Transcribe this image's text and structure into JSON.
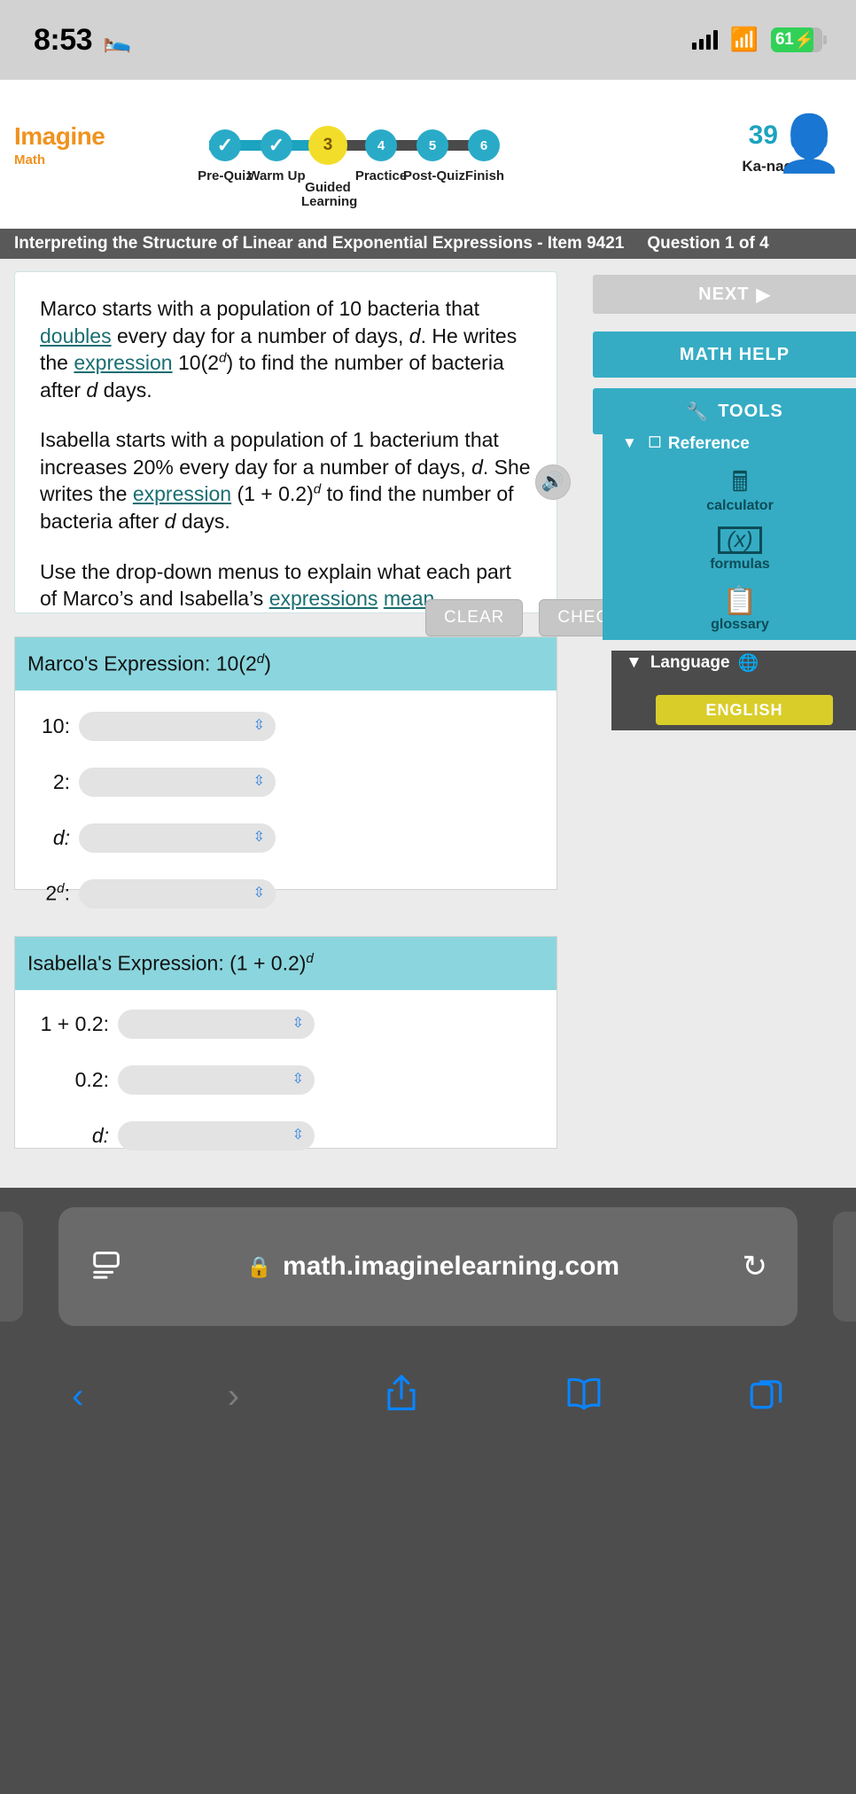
{
  "status_bar": {
    "time": "8:53",
    "bed_icon": "bed-icon",
    "signal_icon": "cellular-signal-icon",
    "wifi_icon": "wifi-icon",
    "battery_level": "61",
    "battery_charging_icon": "bolt-icon"
  },
  "app_header": {
    "logo_line1": "Imagine",
    "logo_line2": "Math",
    "points": "39",
    "user_name": "Ka-nae",
    "user_caret": "▼",
    "avatar_icon": "avatar-icon",
    "progress_steps": [
      {
        "num": "1",
        "label": "Pre-Quiz",
        "state": "complete",
        "mark": "✓"
      },
      {
        "num": "2",
        "label": "Warm Up",
        "state": "complete",
        "mark": "✓"
      },
      {
        "num": "3",
        "label": "Guided Learning",
        "state": "current",
        "mark": "3"
      },
      {
        "num": "4",
        "label": "Practice",
        "state": "upcoming",
        "mark": "4"
      },
      {
        "num": "5",
        "label": "Post-Quiz",
        "state": "upcoming",
        "mark": "5"
      },
      {
        "num": "6",
        "label": "Finish",
        "state": "upcoming",
        "mark": "6"
      }
    ]
  },
  "title_bar": {
    "item_title": "Interpreting the Structure of Linear and Exponential Expressions - Item 9421",
    "question_counter": "Question 1 of 4"
  },
  "question": {
    "audio_icon": "speaker-icon",
    "p1_a": "Marco starts with a population of 10 bacteria that ",
    "p1_link": "doubles",
    "p1_b": " every day for a number of days, ",
    "p1_var1": "d",
    "p1_c": ". He writes the ",
    "p1_link2": "expression",
    "p1_d": " 10(2",
    "p1_sup": "d",
    "p1_e": ") to find the number of bacteria after ",
    "p1_var2": "d",
    "p1_f": " days.",
    "p2_a": "Isabella starts with a population of 1 bacterium that increases 20% every day for a number of days, ",
    "p2_var1": "d",
    "p2_b": ". She writes the ",
    "p2_link": "expression",
    "p2_c": " (1 + 0.2)",
    "p2_sup": "d",
    "p2_d": " to find the number of bacteria after ",
    "p2_var2": "d",
    "p2_e": " days.",
    "p3_a": "Use the drop-down menus to explain what each part of Marco’s and Isabella’s ",
    "p3_link1": "expressions",
    "p3_b": " ",
    "p3_link2": "mean",
    "p3_c": "."
  },
  "actions": {
    "clear_label": "CLEAR",
    "check_label": "CHECK"
  },
  "marco_card": {
    "heading_text": "Marco's Expression: 10(2",
    "heading_sup": "d",
    "heading_tail": ")",
    "rows": [
      {
        "label": "10:",
        "sup": "",
        "value": "",
        "arrow_icon": "select-arrows-icon"
      },
      {
        "label": "2:",
        "sup": "",
        "value": "",
        "arrow_icon": "select-arrows-icon"
      },
      {
        "label": "d:",
        "sup": "",
        "value": "",
        "arrow_icon": "select-arrows-icon"
      },
      {
        "label": "2",
        "sup": "d",
        "value": "",
        "arrow_icon": "select-arrows-icon"
      }
    ]
  },
  "isabella_card": {
    "heading_text": "Isabella's Expression: (1 + 0.2)",
    "heading_sup": "d",
    "rows": [
      {
        "label": "1 + 0.2:",
        "value": "",
        "arrow_icon": "select-arrows-icon"
      },
      {
        "label": "0.2:",
        "value": "",
        "arrow_icon": "select-arrows-icon"
      },
      {
        "label": "d:",
        "value": "",
        "arrow_icon": "select-arrows-icon"
      }
    ]
  },
  "rail": {
    "next_label": "NEXT",
    "next_icon": "play-triangle-icon",
    "math_help_label": "MATH HELP",
    "tools_label": "TOOLS",
    "tools_icon": "wrench-icon",
    "reference_label": "Reference",
    "reference_caret": "▼",
    "reference_icon": "reference-window-icon",
    "reference_items": [
      {
        "icon": "calculator-icon",
        "caption": "calculator"
      },
      {
        "icon": "formulas-icon",
        "caption": "formulas"
      },
      {
        "icon": "glossary-icon",
        "caption": "glossary"
      }
    ],
    "language_label": "Language",
    "language_caret": "▼",
    "language_icon": "globe-icon",
    "language_value": "ENGLISH"
  },
  "browser": {
    "url": "math.imaginelearning.com",
    "lock_icon": "lock-icon",
    "aa_icon": "page-settings-icon",
    "reload_icon": "reload-icon",
    "back_icon": "back-chevron-icon",
    "forward_icon": "forward-chevron-icon",
    "share_icon": "share-icon",
    "bookmarks_icon": "book-icon",
    "tabs_icon": "tabs-icon"
  },
  "colors": {
    "brand_orange": "#f0921e",
    "teal": "#35acc4",
    "light_teal": "#8bd6de",
    "yellow": "#f2de2a",
    "dark_gray": "#595959",
    "ios_blue": "#0a84ff"
  }
}
